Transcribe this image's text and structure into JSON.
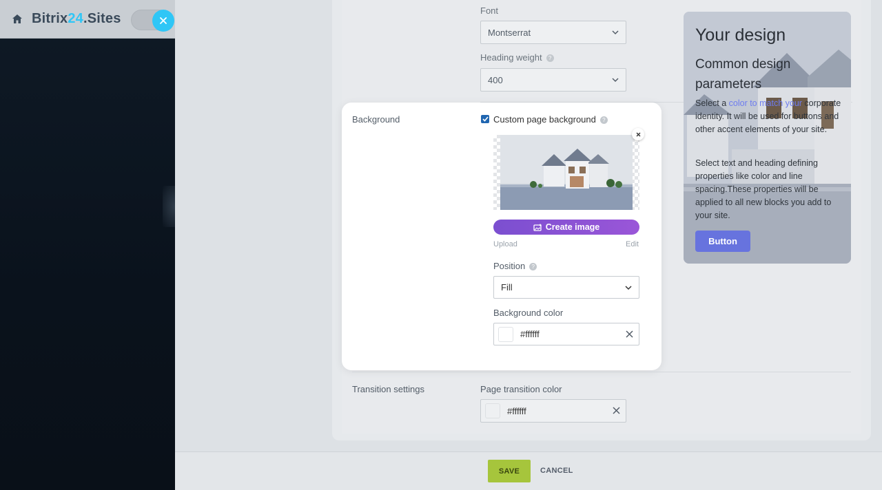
{
  "header": {
    "brand_prefix": "Bitrix",
    "brand_accent": "24",
    "brand_suffix": ".Sites"
  },
  "settings": {
    "font_label": "Font",
    "font_value": "Montserrat",
    "heading_weight_label": "Heading weight",
    "heading_weight_value": "400"
  },
  "preview": {
    "title": "Your design",
    "subtitle": "Common design parameters",
    "text1_before": "Select a ",
    "text1_link": "color to match your",
    "text1_after": "corporate identity. It will be used for buttons and other accent elements of your site.",
    "text2": "Select text and heading defining properties like color and line spacing.These properties will be applied to all new blocks you add to your site.",
    "button_label": "Button"
  },
  "background": {
    "section_label": "Background",
    "custom_bg_label": "Custom page background",
    "custom_bg_checked": true,
    "create_image_label": "Create image",
    "upload_label": "Upload",
    "edit_label": "Edit",
    "position_label": "Position",
    "position_value": "Fill",
    "bg_color_label": "Background color",
    "bg_color_value": "#ffffff"
  },
  "transition": {
    "section_label": "Transition settings",
    "page_transition_label": "Page transition color",
    "page_transition_value": "#ffffff"
  },
  "footer": {
    "save_label": "SAVE",
    "cancel_label": "CANCEL"
  },
  "colors": {
    "accent_blue": "#2fc6f6",
    "save_green": "#a6c53c",
    "preview_button": "#6773de",
    "create_image_gradient_start": "#7b4fd0",
    "create_image_gradient_end": "#9a56d8"
  }
}
